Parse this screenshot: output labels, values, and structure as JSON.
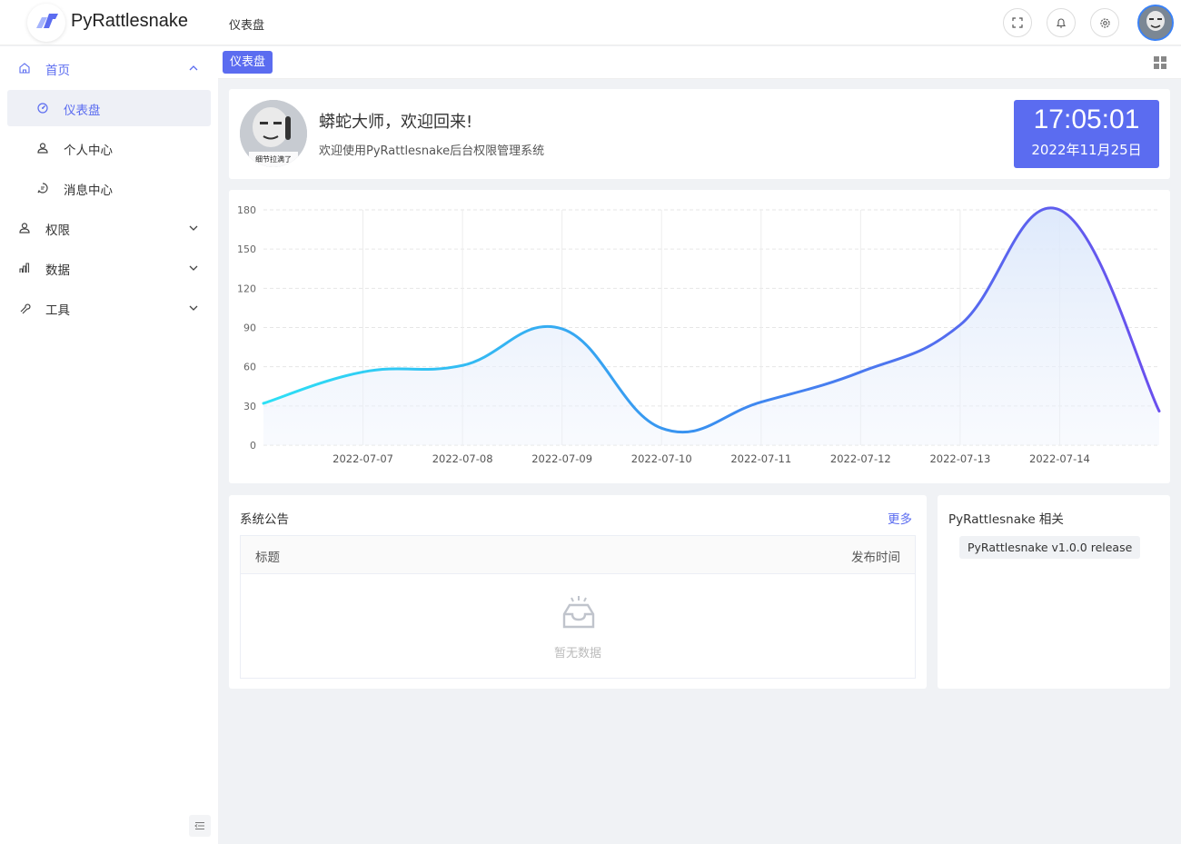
{
  "header": {
    "app_name": "PyRattlesnake",
    "breadcrumb": "仪表盘",
    "buttons": [
      "fullscreen-icon",
      "bell-icon",
      "gear-icon"
    ],
    "accent_color": "#5b6cf0"
  },
  "sidebar": {
    "items": [
      {
        "label": "首页",
        "icon": "home-icon",
        "chevron": "up"
      },
      {
        "label": "仪表盘",
        "icon": "dashboard-icon",
        "active": true
      },
      {
        "label": "个人中心",
        "icon": "user-icon"
      },
      {
        "label": "消息中心",
        "icon": "message-icon"
      },
      {
        "label": "权限",
        "icon": "user-icon",
        "chevron": "down"
      },
      {
        "label": "数据",
        "icon": "bar-chart-icon",
        "chevron": "down"
      },
      {
        "label": "工具",
        "icon": "wrench-icon",
        "chevron": "down"
      }
    ]
  },
  "tabs": {
    "active_label": "仪表盘"
  },
  "welcome": {
    "avatar_caption": "细节拉满了",
    "title": "蟒蛇大师，欢迎回来!",
    "subtitle": "欢迎使用PyRattlesnake后台权限管理系统",
    "time": "17:05:01",
    "date": "2022年11月25日"
  },
  "chart_data": {
    "type": "area",
    "x": [
      "2022-07-06",
      "2022-07-07",
      "2022-07-08",
      "2022-07-09",
      "2022-07-10",
      "2022-07-11",
      "2022-07-12",
      "2022-07-13",
      "2022-07-14",
      "2022-07-15"
    ],
    "tick_labels": [
      "2022-07-07",
      "2022-07-08",
      "2022-07-09",
      "2022-07-10",
      "2022-07-11",
      "2022-07-12",
      "2022-07-13",
      "2022-07-14"
    ],
    "values": [
      32,
      56,
      61,
      89,
      13,
      33,
      56,
      92,
      180,
      26
    ],
    "ylim": [
      0,
      180
    ],
    "yticks": [
      "0",
      "30",
      "60",
      "90",
      "120",
      "150",
      "180"
    ],
    "grid": true,
    "colors": [
      "#2de0f5",
      "#6a4fee"
    ]
  },
  "notice": {
    "title": "系统公告",
    "more": "更多",
    "col_title": "标题",
    "col_time": "发布时间",
    "empty_text": "暂无数据"
  },
  "related": {
    "title": "PyRattlesnake 相关",
    "tag": "PyRattlesnake v1.0.0 release"
  }
}
